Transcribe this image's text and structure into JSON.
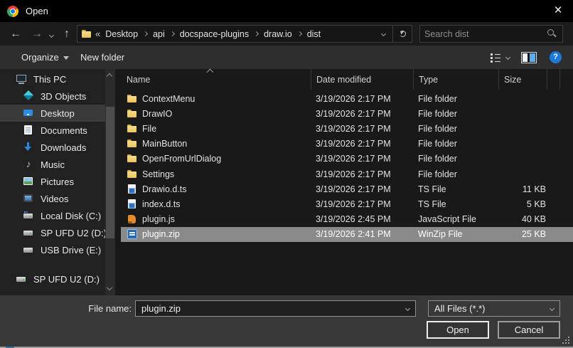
{
  "window": {
    "title": "Open"
  },
  "titlebar": {
    "close_glyph": "×"
  },
  "navbar": {
    "icons": {
      "back": "←",
      "forward": "→",
      "up": "↑"
    },
    "breadcrumb": {
      "prefix": "«",
      "segments": [
        "Desktop",
        "api",
        "docspace-plugins",
        "draw.io",
        "dist"
      ]
    },
    "search": {
      "placeholder": "Search dist"
    }
  },
  "toolbar": {
    "organize_label": "Organize",
    "new_folder_label": "New folder",
    "help_glyph": "?"
  },
  "sidebar": {
    "items": [
      {
        "label": "This PC",
        "icon": "computer",
        "indent": 0,
        "selected": false,
        "gap": false
      },
      {
        "label": "3D Objects",
        "icon": "cube",
        "indent": 1,
        "selected": false,
        "gap": false
      },
      {
        "label": "Desktop",
        "icon": "desktop",
        "indent": 1,
        "selected": true,
        "gap": false
      },
      {
        "label": "Documents",
        "icon": "document",
        "indent": 1,
        "selected": false,
        "gap": false
      },
      {
        "label": "Downloads",
        "icon": "download",
        "indent": 1,
        "selected": false,
        "gap": false
      },
      {
        "label": "Music",
        "icon": "music",
        "indent": 1,
        "selected": false,
        "gap": false
      },
      {
        "label": "Pictures",
        "icon": "picture",
        "indent": 1,
        "selected": false,
        "gap": false
      },
      {
        "label": "Videos",
        "icon": "video",
        "indent": 1,
        "selected": false,
        "gap": false
      },
      {
        "label": "Local Disk (C:)",
        "icon": "disk",
        "indent": 1,
        "selected": false,
        "gap": false
      },
      {
        "label": "SP UFD U2 (D:)",
        "icon": "drive",
        "indent": 1,
        "selected": false,
        "gap": false
      },
      {
        "label": "USB Drive (E:)",
        "icon": "drive",
        "indent": 1,
        "selected": false,
        "gap": false
      },
      {
        "label": "SP UFD U2 (D:)",
        "icon": "drive",
        "indent": 0,
        "selected": false,
        "gap": true
      }
    ]
  },
  "filelist": {
    "columns": [
      "Name",
      "Date modified",
      "Type",
      "Size"
    ],
    "sort_column": "Name",
    "sort_ascending": true,
    "rows": [
      {
        "name": "ContextMenu",
        "icon": "folder",
        "date": "3/19/2026 2:17 PM",
        "type": "File folder",
        "size": "",
        "selected": false
      },
      {
        "name": "DrawIO",
        "icon": "folder",
        "date": "3/19/2026 2:17 PM",
        "type": "File folder",
        "size": "",
        "selected": false
      },
      {
        "name": "File",
        "icon": "folder",
        "date": "3/19/2026 2:17 PM",
        "type": "File folder",
        "size": "",
        "selected": false
      },
      {
        "name": "MainButton",
        "icon": "folder",
        "date": "3/19/2026 2:17 PM",
        "type": "File folder",
        "size": "",
        "selected": false
      },
      {
        "name": "OpenFromUrlDialog",
        "icon": "folder",
        "date": "3/19/2026 2:17 PM",
        "type": "File folder",
        "size": "",
        "selected": false
      },
      {
        "name": "Settings",
        "icon": "folder",
        "date": "3/19/2026 2:17 PM",
        "type": "File folder",
        "size": "",
        "selected": false
      },
      {
        "name": "Drawio.d.ts",
        "icon": "ts",
        "date": "3/19/2026 2:17 PM",
        "type": "TS File",
        "size": "11 KB",
        "selected": false
      },
      {
        "name": "index.d.ts",
        "icon": "ts",
        "date": "3/19/2026 2:17 PM",
        "type": "TS File",
        "size": "5 KB",
        "selected": false
      },
      {
        "name": "plugin.js",
        "icon": "js",
        "date": "3/19/2026 2:45 PM",
        "type": "JavaScript File",
        "size": "40 KB",
        "selected": false
      },
      {
        "name": "plugin.zip",
        "icon": "zip",
        "date": "3/19/2026 2:41 PM",
        "type": "WinZip File",
        "size": "25 KB",
        "selected": true
      }
    ]
  },
  "footer": {
    "file_name_label": "File name:",
    "file_name_value": "plugin.zip",
    "file_type_value": "All Files (*.*)",
    "open_label": "Open",
    "cancel_label": "Cancel"
  },
  "icon_glyphs": {
    "music": "♪"
  },
  "colors": {
    "titlebar_bg": "#000000",
    "window_bg": "#383838",
    "list_bg": "#191919",
    "selection_gray": "#8a8a8a",
    "sidebar_selection": "#3a3a3a",
    "folder_yellow": "#ecc35f",
    "accent_blue": "#1c79d8"
  }
}
